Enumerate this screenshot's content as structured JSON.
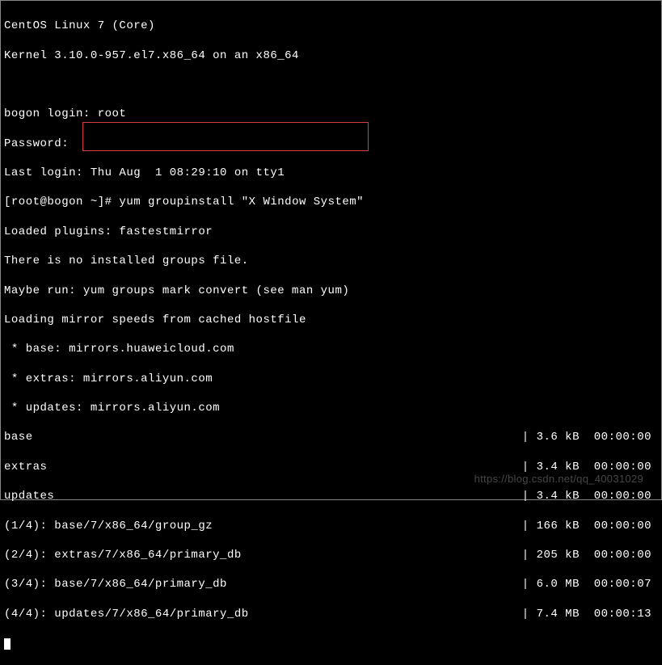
{
  "header": {
    "os": "CentOS Linux 7 (Core)",
    "kernel": "Kernel 3.10.0-957.el7.x86_64 on an x86_64"
  },
  "login": {
    "prompt": "bogon login: root",
    "password": "Password:",
    "last_login": "Last login: Thu Aug  1 08:29:10 on tty1"
  },
  "command": {
    "prompt": "[root@bogon ~]#",
    "cmd": " yum groupinstall \"X Window System\""
  },
  "output": {
    "loaded_plugins": "Loaded plugins: fastestmirror",
    "no_groups": "There is no installed groups file.",
    "maybe_run": "Maybe run: yum groups mark convert (see man yum)",
    "loading_mirror": "Loading mirror speeds from cached hostfile",
    "mirror_base": " * base: mirrors.huaweicloud.com",
    "mirror_extras": " * extras: mirrors.aliyun.com",
    "mirror_updates": " * updates: mirrors.aliyun.com"
  },
  "repos": [
    {
      "name": "base",
      "stats": "| 3.6 kB  00:00:00"
    },
    {
      "name": "extras",
      "stats": "| 3.4 kB  00:00:00"
    },
    {
      "name": "updates",
      "stats": "| 3.4 kB  00:00:00"
    },
    {
      "name": "(1/4): base/7/x86_64/group_gz",
      "stats": "| 166 kB  00:00:00"
    },
    {
      "name": "(2/4): extras/7/x86_64/primary_db",
      "stats": "| 205 kB  00:00:00"
    },
    {
      "name": "(3/4): base/7/x86_64/primary_db",
      "stats": "| 6.0 MB  00:00:07"
    },
    {
      "name": "(4/4): updates/7/x86_64/primary_db",
      "stats": "| 7.4 MB  00:00:13"
    }
  ],
  "watermark": "https://blog.csdn.net/qq_40031029"
}
